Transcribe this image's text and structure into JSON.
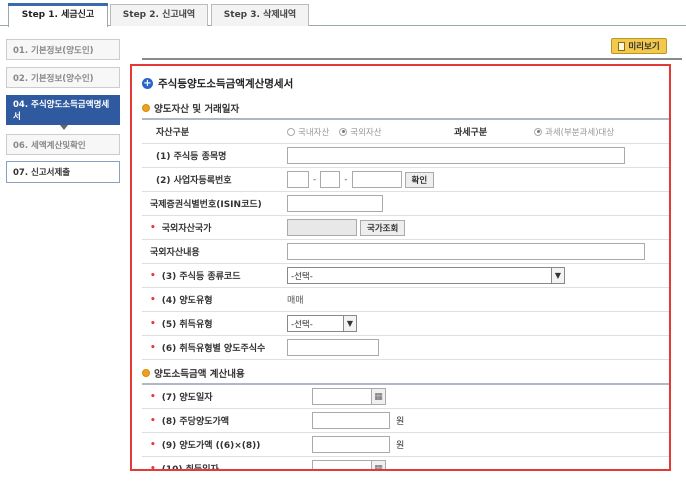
{
  "tabs": [
    {
      "label": "Step 1. 세금신고",
      "active": true
    },
    {
      "label": "Step 2. 신고내역",
      "active": false
    },
    {
      "label": "Step 3. 삭제내역",
      "active": false
    }
  ],
  "steps": [
    {
      "label": "01. 기본정보(양도인)"
    },
    {
      "label": "02. 기본정보(양수인)"
    },
    {
      "label": "04. 주식양도소득금액명세서"
    },
    {
      "label": "06. 세액계산및확인"
    },
    {
      "label": "07. 신고서제출"
    }
  ],
  "preview_label": "미리보기",
  "form": {
    "title": "주식등양도소득금액계산명세서",
    "section1": "양도자산 및 거래일자",
    "asset_type": {
      "label": "자산구분",
      "options": [
        "국내자산",
        "국외자산"
      ],
      "selected": "국외자산",
      "tax_label": "과세구분",
      "tax_option": "과세(부분과세)대상"
    },
    "stock_name": {
      "label": "(1) 주식등 종목명"
    },
    "biz_no": {
      "label": "(2) 사업자등록번호",
      "button": "확인"
    },
    "isin": {
      "label": "국제증권식별번호(ISIN코드)"
    },
    "foreign_country": {
      "label": "국외자산국가",
      "button": "국가조회"
    },
    "foreign_content": {
      "label": "국외자산내용"
    },
    "stock_kind": {
      "label": "(3) 주식등 종류코드",
      "value": "-선택-"
    },
    "transfer_type": {
      "label": "(4) 양도유형",
      "value": "매매"
    },
    "acquire_type": {
      "label": "(5) 취득유형",
      "value": "-선택-"
    },
    "shares": {
      "label": "(6) 취득유형별 양도주식수"
    },
    "section2": "양도소득금액 계산내용",
    "transfer_date": {
      "label": "(7) 양도일자"
    },
    "price_per_share": {
      "label": "(8) 주당양도가액",
      "unit": "원"
    },
    "transfer_price": {
      "label": "(9) 양도가액 ((6)×(8))",
      "unit": "원"
    },
    "acquire_date": {
      "label": "(10) 취득일자"
    }
  }
}
